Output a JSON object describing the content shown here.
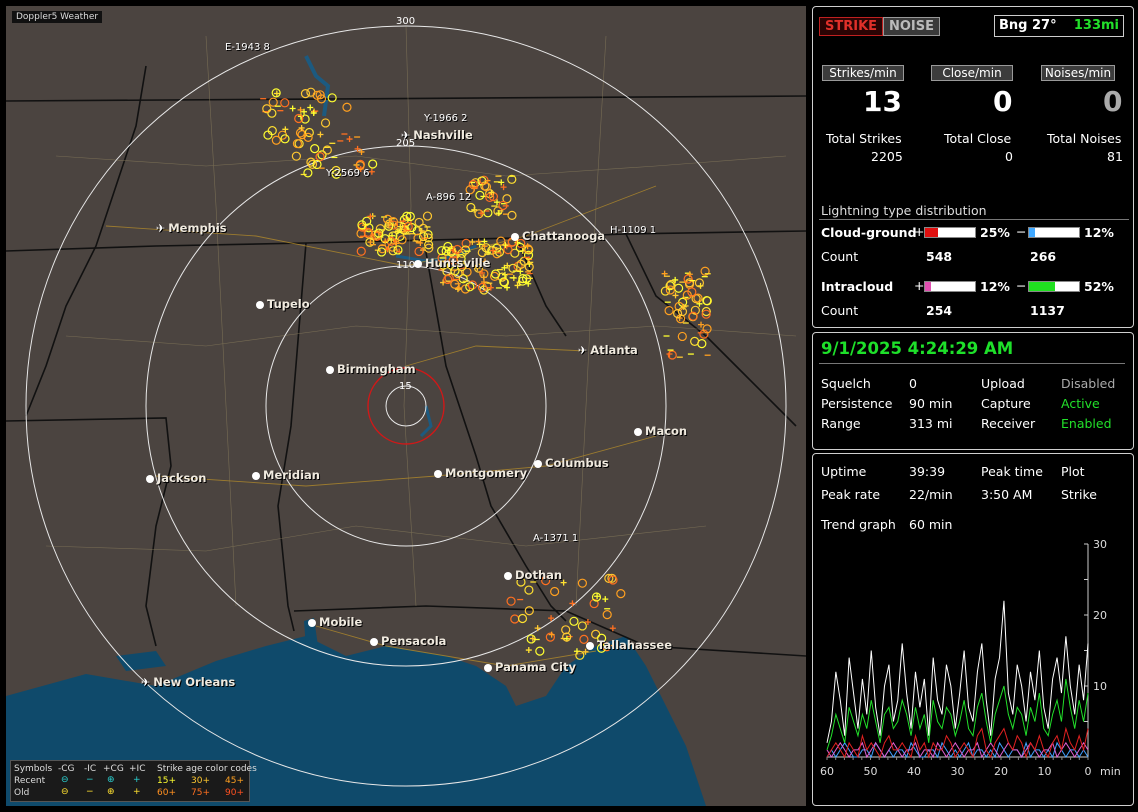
{
  "app_title": "Doppler5 Weather",
  "colors": {
    "land": "#4b4440",
    "water": "#0f4a6b",
    "ring": "#e8e8e8",
    "close_ring": "#d01818",
    "border": "#101010",
    "county": "#8a7e5c",
    "road": "#9c7f2a"
  },
  "map": {
    "ring_labels": [
      "300",
      "205",
      "110",
      "15"
    ],
    "cities": [
      {
        "name": "Nashville",
        "icon": "plane"
      },
      {
        "name": "Memphis",
        "icon": "plane"
      },
      {
        "name": "Chattanooga",
        "icon": "dot"
      },
      {
        "name": "Huntsville",
        "icon": "dot"
      },
      {
        "name": "Tupelo",
        "icon": "dot"
      },
      {
        "name": "Atlanta",
        "icon": "plane"
      },
      {
        "name": "Birmingham",
        "icon": "dot"
      },
      {
        "name": "Macon",
        "icon": "dot"
      },
      {
        "name": "Jackson",
        "icon": "dot"
      },
      {
        "name": "Meridian",
        "icon": "dot"
      },
      {
        "name": "Montgomery",
        "icon": "dot"
      },
      {
        "name": "Columbus",
        "icon": "dot"
      },
      {
        "name": "Dothan",
        "icon": "dot"
      },
      {
        "name": "Mobile",
        "icon": "dot"
      },
      {
        "name": "Pensacola",
        "icon": "dot"
      },
      {
        "name": "Tallahassee",
        "icon": "dot"
      },
      {
        "name": "Panama City",
        "icon": "dot"
      },
      {
        "name": "New Orleans",
        "icon": "plane"
      }
    ],
    "storm_labels": [
      "E-1943 8",
      "Y-1966 2",
      "Y-2569 6",
      "A-896 12",
      "H-1109 1",
      "A-1371 1"
    ],
    "legend": {
      "symbols_label": "Symbols",
      "cols": [
        "-CG",
        "-IC",
        "+CG",
        "+IC"
      ],
      "age_label": "Strike age color codes",
      "recent_label": "Recent",
      "old_label": "Old",
      "recent_ages": [
        "15+",
        "30+",
        "45+"
      ],
      "old_ages": [
        "60+",
        "75+",
        "90+"
      ]
    }
  },
  "panel1": {
    "strike_btn": "STRIKE",
    "noise_btn": "NOISE",
    "bearing": "Bng 27°",
    "distance": "133mi",
    "rates": [
      {
        "label": "Strikes/min",
        "value": "13"
      },
      {
        "label": "Close/min",
        "value": "0"
      },
      {
        "label": "Noises/min",
        "value": "0"
      }
    ],
    "totals": [
      {
        "label": "Total Strikes",
        "value": "2205"
      },
      {
        "label": "Total Close",
        "value": "0"
      },
      {
        "label": "Total Noises",
        "value": "81"
      }
    ],
    "dist_title": "Lightning type distribution",
    "cg": {
      "label": "Cloud-ground",
      "plus_pct": "25%",
      "minus_pct": "12%",
      "plus_count": "548",
      "minus_count": "266",
      "plus_frac": 0.25,
      "minus_frac": 0.12
    },
    "ic": {
      "label": "Intracloud",
      "plus_pct": "12%",
      "minus_pct": "52%",
      "plus_count": "254",
      "minus_count": "1137",
      "plus_frac": 0.12,
      "minus_frac": 0.52
    },
    "count_label": "Count",
    "plus_sign": "+",
    "minus_sign": "−"
  },
  "panel2": {
    "datetime": "9/1/2025 4:24:29 AM",
    "rows": [
      {
        "k1": "Squelch",
        "v1": "0",
        "k2": "Upload",
        "v2": "Disabled"
      },
      {
        "k1": "Persistence",
        "v1": "90 min",
        "k2": "Capture",
        "v2": "Active"
      },
      {
        "k1": "Range",
        "v1": "313 mi",
        "k2": "Receiver",
        "v2": "Enabled"
      }
    ]
  },
  "panel3": {
    "uptime_label": "Uptime",
    "uptime": "39:39",
    "peak_time_label": "Peak time",
    "plot_label": "Plot",
    "peak_rate_label": "Peak rate",
    "peak_rate": "22/min",
    "peak_time": "3:50 AM",
    "plot_value": "Strike",
    "trend_label": "Trend graph",
    "trend_value": "60 min"
  },
  "chart_data": {
    "type": "line",
    "xlabel": "min",
    "x_ticks": [
      "60",
      "50",
      "40",
      "30",
      "20",
      "10",
      "0"
    ],
    "y_ticks": [
      "30",
      "20",
      "10"
    ],
    "xlim": [
      60,
      0
    ],
    "ylim": [
      0,
      30
    ],
    "series": [
      {
        "color": "#ffffff",
        "values": [
          2,
          5,
          12,
          8,
          3,
          14,
          9,
          4,
          11,
          6,
          15,
          7,
          3,
          10,
          13,
          5,
          8,
          16,
          9,
          4,
          12,
          7,
          11,
          3,
          14,
          8,
          6,
          13,
          10,
          4,
          9,
          15,
          7,
          5,
          12,
          16,
          8,
          3,
          11,
          14,
          22,
          9,
          6,
          13,
          10,
          5,
          12,
          8,
          15,
          7,
          4,
          11,
          14,
          9,
          17,
          10,
          6,
          13,
          8,
          16
        ]
      },
      {
        "color": "#22e02a",
        "values": [
          1,
          3,
          6,
          4,
          2,
          7,
          5,
          3,
          6,
          4,
          8,
          5,
          2,
          6,
          7,
          4,
          5,
          8,
          6,
          3,
          7,
          4,
          6,
          2,
          8,
          5,
          4,
          7,
          6,
          3,
          5,
          8,
          4,
          3,
          7,
          9,
          5,
          2,
          6,
          8,
          10,
          6,
          4,
          7,
          6,
          3,
          7,
          5,
          9,
          4,
          3,
          6,
          8,
          5,
          11,
          7,
          4,
          8,
          5,
          9
        ]
      },
      {
        "color": "#e02020",
        "values": [
          0,
          1,
          2,
          1,
          0,
          2,
          1,
          0,
          3,
          1,
          2,
          1,
          0,
          2,
          3,
          1,
          1,
          2,
          1,
          0,
          3,
          1,
          2,
          0,
          2,
          1,
          1,
          3,
          2,
          0,
          1,
          2,
          1,
          0,
          3,
          4,
          1,
          0,
          2,
          3,
          4,
          2,
          1,
          3,
          2,
          0,
          2,
          1,
          3,
          1,
          0,
          2,
          3,
          1,
          4,
          2,
          1,
          3,
          1,
          4
        ]
      },
      {
        "color": "#e060d0",
        "values": [
          1,
          0,
          1,
          2,
          1,
          0,
          1,
          1,
          2,
          0,
          1,
          2,
          1,
          0,
          1,
          2,
          1,
          0,
          1,
          1,
          2,
          0,
          1,
          1,
          0,
          2,
          1,
          0,
          1,
          2,
          1,
          0,
          1,
          1,
          2,
          0,
          1,
          2,
          1,
          0,
          1,
          2,
          1,
          1,
          0,
          1,
          2,
          1,
          0,
          1,
          1,
          2,
          0,
          1,
          2,
          1,
          0,
          1,
          2,
          1
        ]
      },
      {
        "color": "#40a0ff",
        "values": [
          0,
          1,
          0,
          1,
          2,
          1,
          0,
          0,
          1,
          1,
          0,
          2,
          1,
          0,
          1,
          0,
          1,
          1,
          0,
          2,
          1,
          0,
          0,
          1,
          1,
          0,
          2,
          1,
          0,
          1,
          0,
          1,
          2,
          0,
          1,
          1,
          0,
          1,
          0,
          2,
          1,
          0,
          1,
          1,
          0,
          2,
          0,
          1,
          1,
          0,
          1,
          0,
          2,
          1,
          0,
          1,
          1,
          0,
          1,
          0
        ]
      }
    ]
  }
}
